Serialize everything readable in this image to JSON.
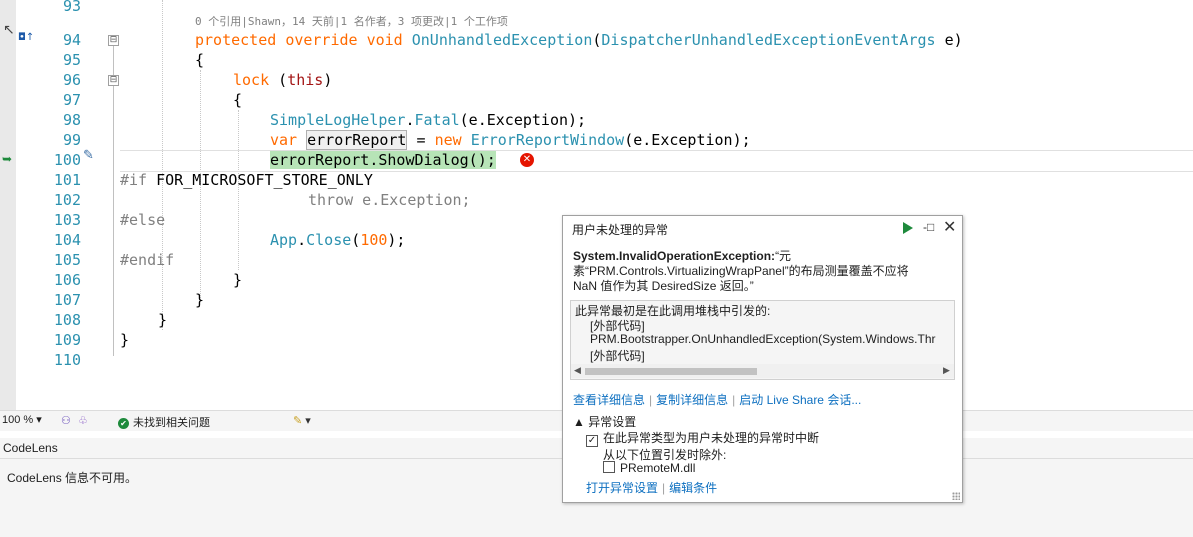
{
  "editor": {
    "codelens_hint": "0 个引用|Shawn，14 天前|1 名作者，3 项更改|1 个工作项",
    "line_numbers": [
      "93",
      "94",
      "95",
      "96",
      "97",
      "98",
      "99",
      "100",
      "101",
      "102",
      "103",
      "104",
      "105",
      "106",
      "107",
      "108",
      "109",
      "110"
    ],
    "code": {
      "l94_protected": "protected",
      "l94_override": "override",
      "l94_void": "void",
      "l94_method": "OnUnhandledException",
      "l94_paren_open": "(",
      "l94_type": "DispatcherUnhandledExceptionEventArgs",
      "l94_param": " e)",
      "l95": "{",
      "l96_lock": "lock",
      "l96_rest_open": " (",
      "l96_this": "this",
      "l96_rest_close": ")",
      "l97": "{",
      "l98_type": "SimpleLogHelper",
      "l98_dot": ".",
      "l98_method": "Fatal",
      "l98_rest": "(e.Exception);",
      "l99_var": "var",
      "l99_name": "errorReport",
      "l99_eq": " = ",
      "l99_new": "new",
      "l99_type": "ErrorReportWindow",
      "l99_rest": "(e.Exception);",
      "l100": "errorReport.ShowDialog();",
      "l101_if": "#if",
      "l101_sym": " FOR_MICROSOFT_STORE_ONLY",
      "l102": "throw e.Exception;",
      "l103": "#else",
      "l104_type": "App",
      "l104_dot": ".",
      "l104_method": "Close",
      "l104_open": "(",
      "l104_num": "100",
      "l104_close": ");",
      "l105": "#endif",
      "l106": "}",
      "l107": "}",
      "l108": "}",
      "l109": "}"
    },
    "collapse_glyph": "⊟",
    "error_glyph": "✕"
  },
  "status_bar": {
    "zoom": "100 %",
    "issues": "未找到相关问题",
    "ok_glyph": "✔"
  },
  "codelens_panel": {
    "tab_title": "CodeLens",
    "message": "CodeLens 信息不可用。"
  },
  "exception_popup": {
    "title": "用户未处理的异常",
    "exception_type": "System.InvalidOperationException:",
    "message_line1": "“元",
    "message_line2": "素“PRM.Controls.VirtualizingWrapPanel”的布局测量覆盖不应将",
    "message_line3": "NaN 值作为其 DesiredSize 返回。”",
    "stack_header": "此异常最初是在此调用堆栈中引发的:",
    "stack_lines": [
      "[外部代码]",
      "PRM.Bootstrapper.OnUnhandledException(System.Windows.Thr",
      "[外部代码]"
    ],
    "link_details": "查看详细信息",
    "link_copy": "复制详细信息",
    "link_liveshare": "启动 Live Share 会话...",
    "settings_header": "▲ 异常设置",
    "break_label": "在此异常类型为用户未处理的异常时中断",
    "break_checked": "✓",
    "except_label": "从以下位置引发时除外:",
    "module_label": "PRemoteM.dll",
    "link_open_settings": "打开异常设置",
    "link_edit_conditions": "编辑条件",
    "pin_glyph": "-□",
    "close_glyph": "✕"
  }
}
